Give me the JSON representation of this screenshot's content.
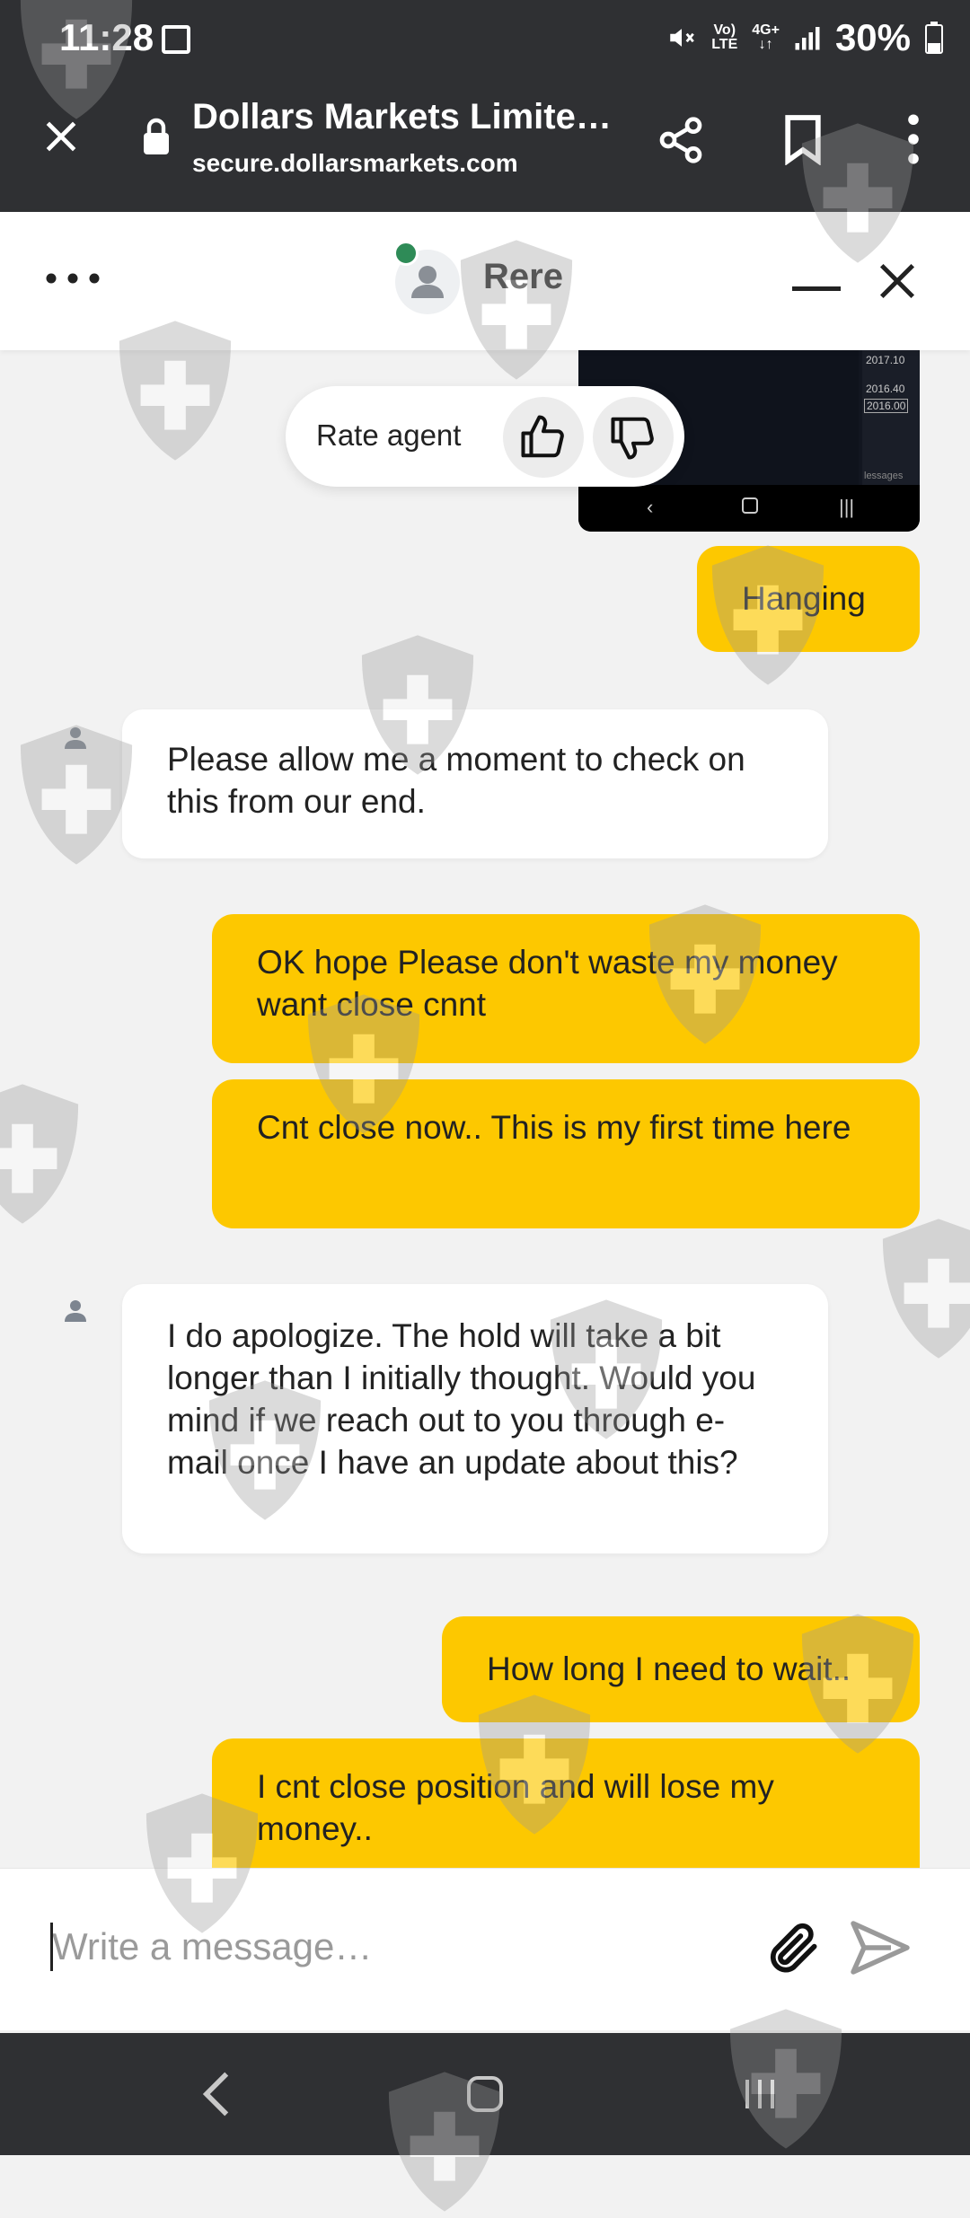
{
  "status_bar": {
    "time": "11:28",
    "volte_top": "Vo)",
    "volte_bottom": "LTE",
    "net_top": "4G+",
    "net_bottom": "↓↑",
    "battery": "30%"
  },
  "browser": {
    "title": "Dollars Markets Limite…",
    "url": "secure.dollarsmarkets.com"
  },
  "chat_header": {
    "agent_name": "Rere"
  },
  "preview_image": {
    "values": [
      "2017.10",
      "2016.40",
      "2016.00"
    ],
    "label": "lessages"
  },
  "rating": {
    "label": "Rate agent"
  },
  "messages": [
    {
      "from": "user",
      "text": "Hanging"
    },
    {
      "from": "agent",
      "text": "Please allow me a moment to check on this from our end."
    },
    {
      "from": "user",
      "text": "OK hope Please don't waste my money want close cnnt"
    },
    {
      "from": "user",
      "text": "Cnt close now.. This is my first time here"
    },
    {
      "from": "agent",
      "text": "I do apologize. The hold will take a bit longer than I initially thought. Would you mind if we reach out to you through e-mail once I have an update about this?"
    },
    {
      "from": "user",
      "text": "How long I need to wait.."
    },
    {
      "from": "user",
      "text": "I cnt close position and will lose my money.."
    }
  ],
  "composer": {
    "placeholder": "Write a message…"
  },
  "colors": {
    "user_bubble": "#fdc800",
    "agent_bubble": "#ffffff",
    "online": "#2e8b57",
    "system_bar": "#2f3033"
  }
}
